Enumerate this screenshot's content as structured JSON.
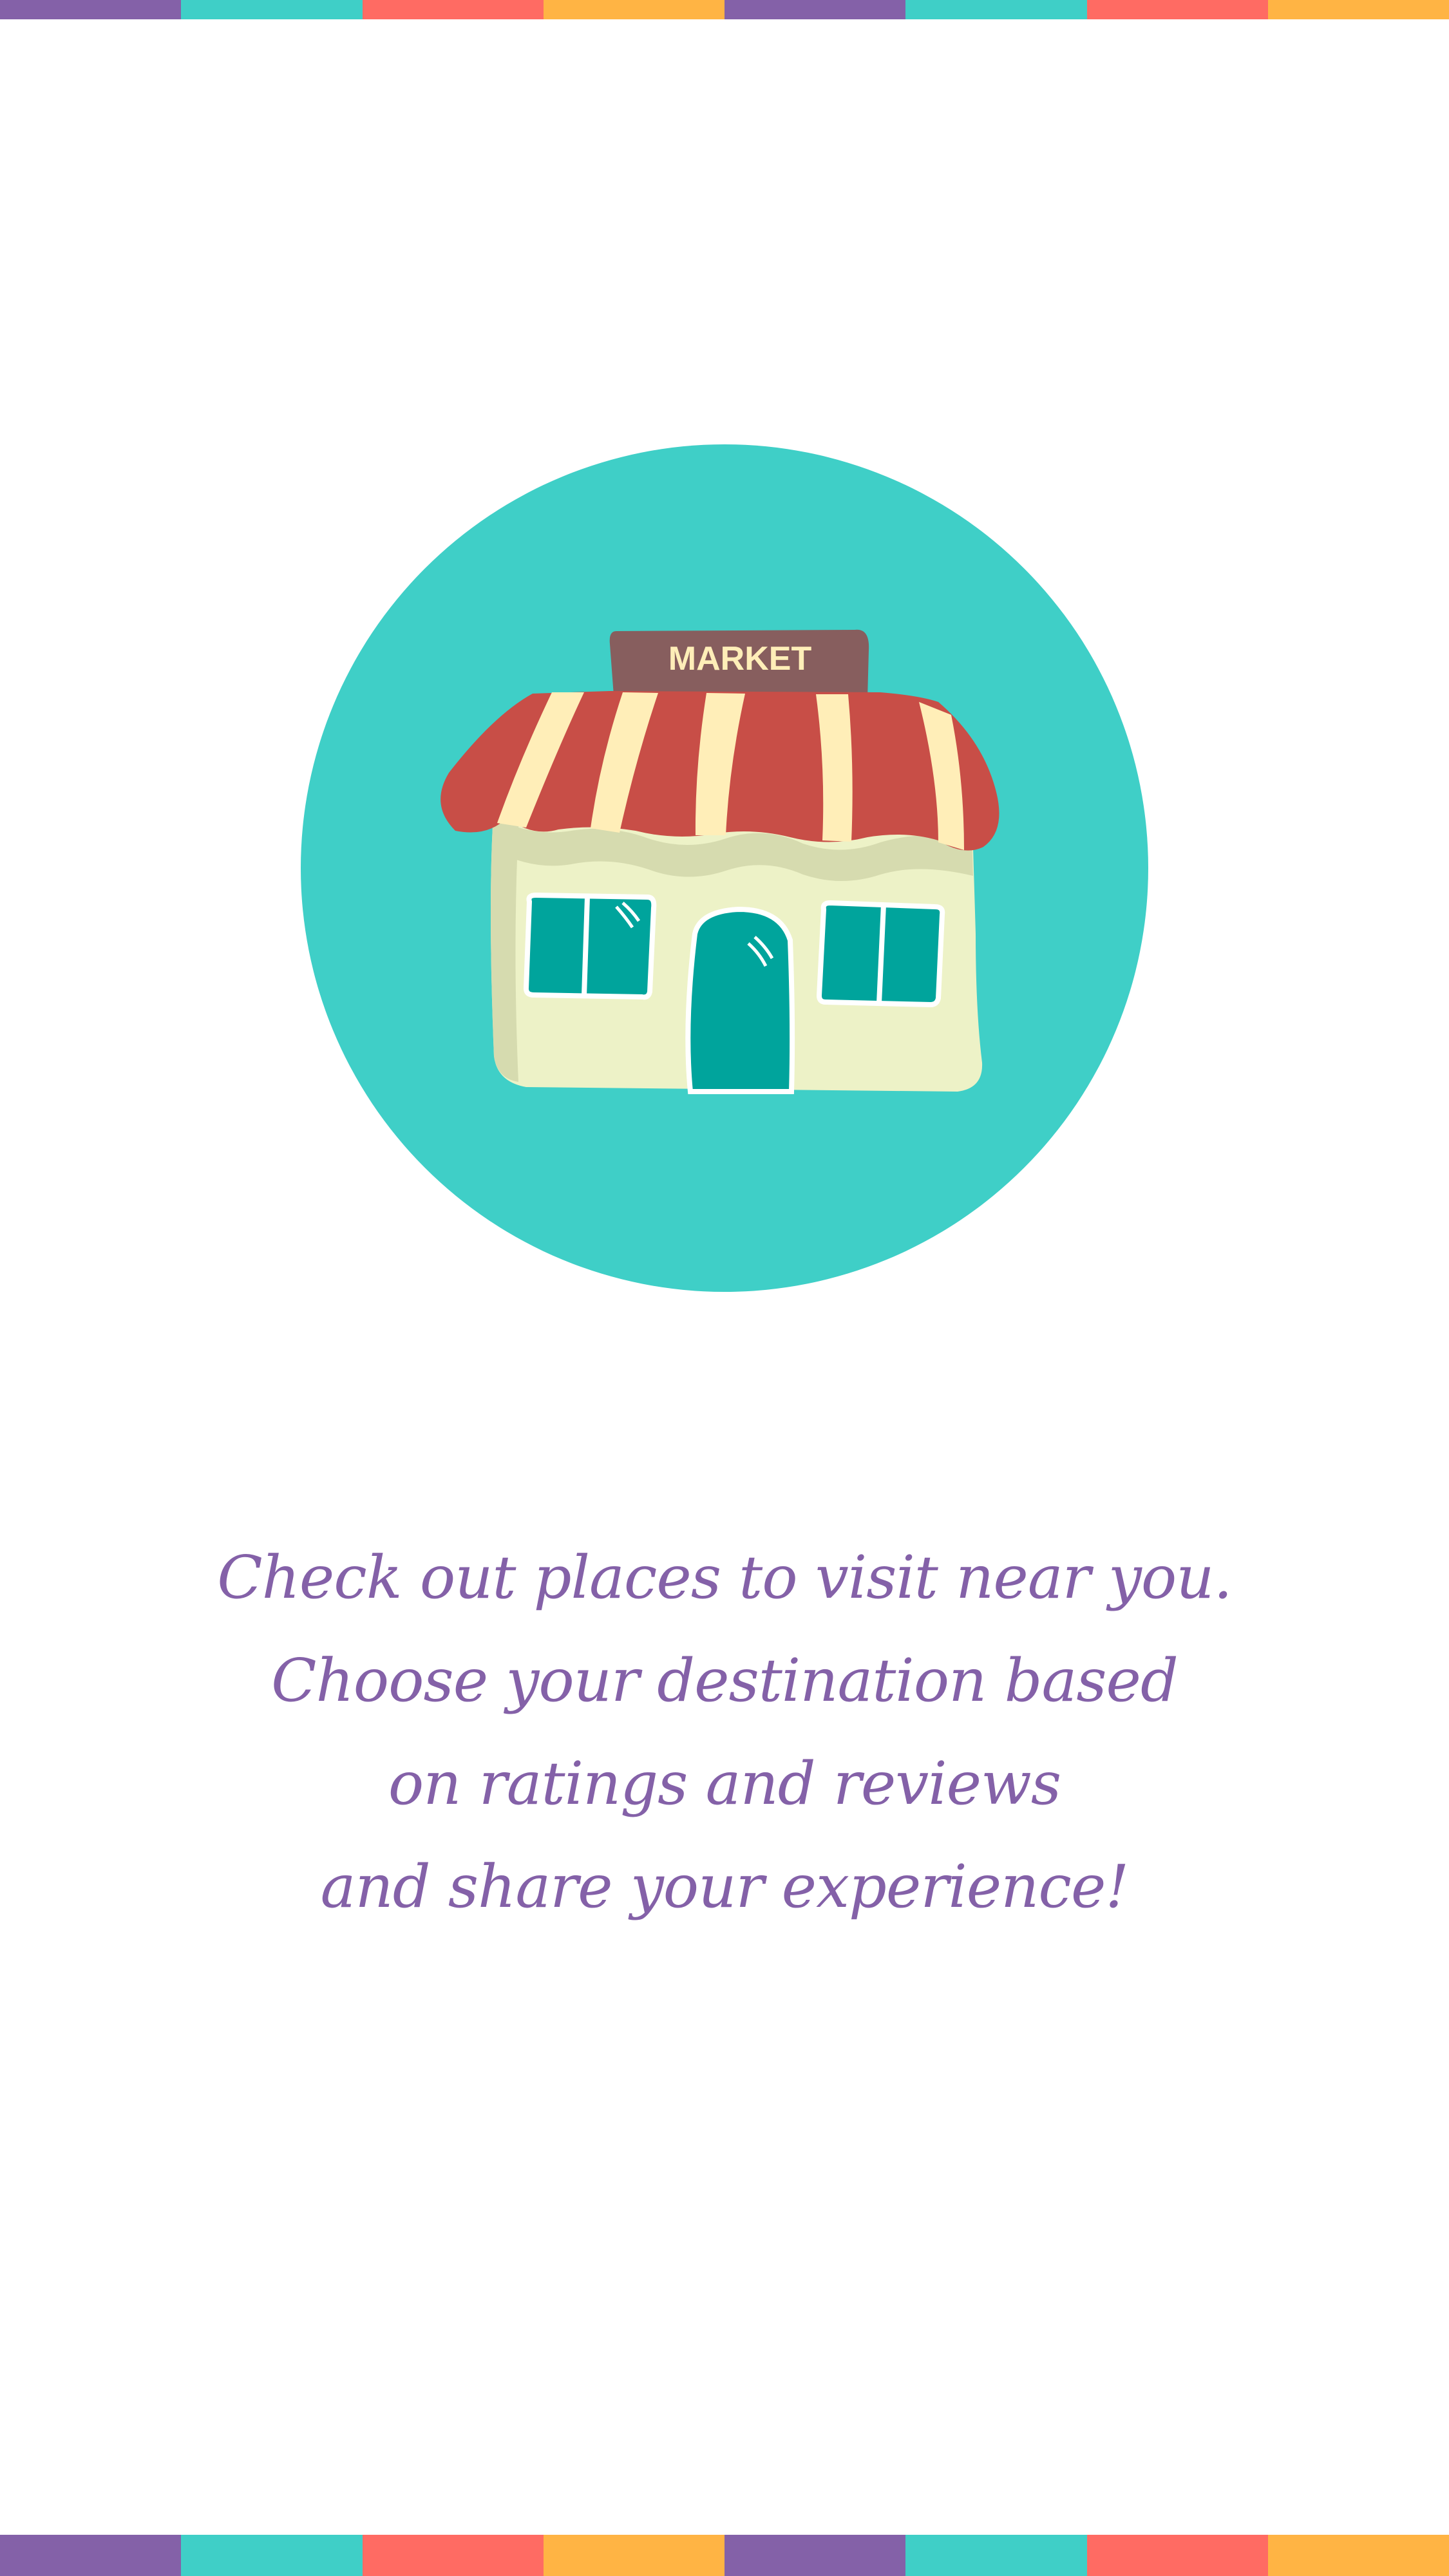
{
  "colors": {
    "purple": "#8461A8",
    "teal": "#3FCFC7",
    "coral": "#FF6B63",
    "orange": "#FFB444",
    "circle": "#3FCFC7",
    "awning_red": "#C84E47",
    "awning_cream": "#FFEEB8",
    "sign": "#875E5E",
    "wall": "#EDF2C7",
    "wall_shadow": "#D6DBAF",
    "door_window": "#00A49C",
    "text": "#8461A8"
  },
  "stripes": {
    "top": [
      "#8461A8",
      "#3FCFC7",
      "#FF6B63",
      "#FFB444",
      "#8461A8",
      "#3FCFC7",
      "#FF6B63",
      "#FFB444"
    ],
    "bottom": [
      "#8461A8",
      "#3FCFC7",
      "#FF6B63",
      "#FFB444",
      "#8461A8",
      "#3FCFC7",
      "#FF6B63",
      "#FFB444"
    ]
  },
  "illustration": {
    "icon": "market-storefront-icon",
    "sign_text": "MARKET"
  },
  "tagline": {
    "lines": [
      "Check out places to visit near you.",
      "Choose your destination based",
      "on ratings and reviews",
      "and share your experience!"
    ]
  }
}
